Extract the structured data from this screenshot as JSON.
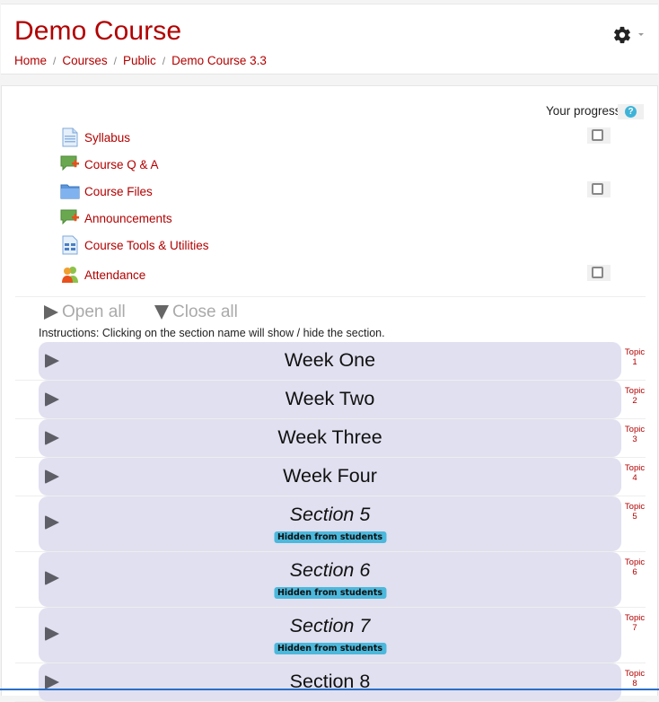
{
  "header": {
    "title": "Demo Course",
    "breadcrumb": [
      "Home",
      "Courses",
      "Public",
      "Demo Course 3.3"
    ],
    "breadcrumb_separator": "/",
    "settings_icon": "gear-icon"
  },
  "progress": {
    "label": "Your progress",
    "help_icon": "?"
  },
  "activities": [
    {
      "name": "Syllabus",
      "icon": "page-icon",
      "has_checkbox": true,
      "checked": false
    },
    {
      "name": "Course Q & A",
      "icon": "forum-icon",
      "has_checkbox": false
    },
    {
      "name": "Course Files",
      "icon": "folder-icon",
      "has_checkbox": true,
      "checked": false
    },
    {
      "name": "Announcements",
      "icon": "forum-icon",
      "has_checkbox": false
    },
    {
      "name": "Course Tools & Utilities",
      "icon": "book-icon",
      "has_checkbox": false
    },
    {
      "name": "Attendance",
      "icon": "attendance-icon",
      "has_checkbox": true,
      "checked": false
    }
  ],
  "controls": {
    "open_all": "Open all",
    "close_all": "Close all",
    "instructions": "Instructions: Clicking on the section name will show / hide the section."
  },
  "sections": [
    {
      "title": "Week One",
      "hidden": false,
      "topic_label": "Topic",
      "topic_number": "1"
    },
    {
      "title": "Week Two",
      "hidden": false,
      "topic_label": "Topic",
      "topic_number": "2"
    },
    {
      "title": "Week Three",
      "hidden": false,
      "topic_label": "Topic",
      "topic_number": "3"
    },
    {
      "title": "Week Four",
      "hidden": false,
      "topic_label": "Topic",
      "topic_number": "4"
    },
    {
      "title": "Section 5",
      "hidden": true,
      "badge": "Hidden from students",
      "topic_label": "Topic",
      "topic_number": "5"
    },
    {
      "title": "Section 6",
      "hidden": true,
      "badge": "Hidden from students",
      "topic_label": "Topic",
      "topic_number": "6"
    },
    {
      "title": "Section 7",
      "hidden": true,
      "badge": "Hidden from students",
      "topic_label": "Topic",
      "topic_number": "7"
    },
    {
      "title": "Section 8",
      "hidden": false,
      "topic_label": "Topic",
      "topic_number": "8"
    }
  ],
  "colors": {
    "brand": "#b20000",
    "section_bg": "#e0e0f0",
    "badge_bg": "#4cb8dc",
    "help_icon": "#3fb3d8"
  }
}
